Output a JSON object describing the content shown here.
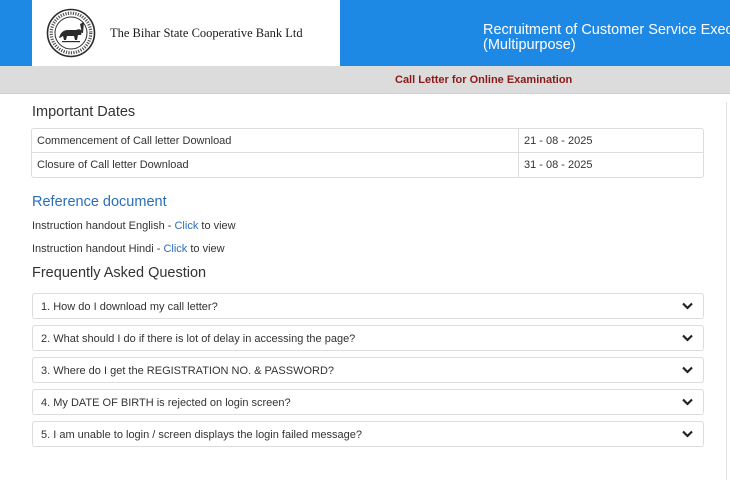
{
  "header": {
    "bank_name": "The Bihar State Cooperative Bank Ltd",
    "logo_seal_text": "THE BIHAR STATE CO-OPERATIVE BANK LTD. PATNA · 1914",
    "recruitment_title_line1": "Recruitment of Customer Service Exec",
    "recruitment_title_line2": "(Multipurpose)"
  },
  "subbar": {
    "title": "Call Letter for Online Examination"
  },
  "important_dates": {
    "heading": "Important Dates",
    "rows": [
      {
        "label": "Commencement of Call letter Download",
        "value": "21 - 08 - 2025"
      },
      {
        "label": "Closure of Call letter Download",
        "value": "31 - 08 - 2025"
      }
    ]
  },
  "reference": {
    "heading": "Reference document",
    "items": [
      {
        "prefix": "Instruction handout English - ",
        "link": "Click",
        "suffix": " to view"
      },
      {
        "prefix": "Instruction handout Hindi - ",
        "link": "Click",
        "suffix": " to view"
      }
    ]
  },
  "faq": {
    "heading": "Frequently Asked Question",
    "items": [
      "1. How do I download my call letter?",
      "2. What should I do if there is lot of delay in accessing the page?",
      "3. Where do I get the REGISTRATION NO. & PASSWORD?",
      "4. My DATE OF BIRTH is rejected on login screen?",
      "5. I am unable to login / screen displays the login failed message?"
    ]
  },
  "colors": {
    "header_blue": "#1e88e5",
    "link_blue": "#2a6ebb",
    "subbar_title": "#8b1a1a"
  },
  "icons": {
    "faq_toggle": "chevron-down-icon",
    "logo": "bank-seal-logo"
  }
}
